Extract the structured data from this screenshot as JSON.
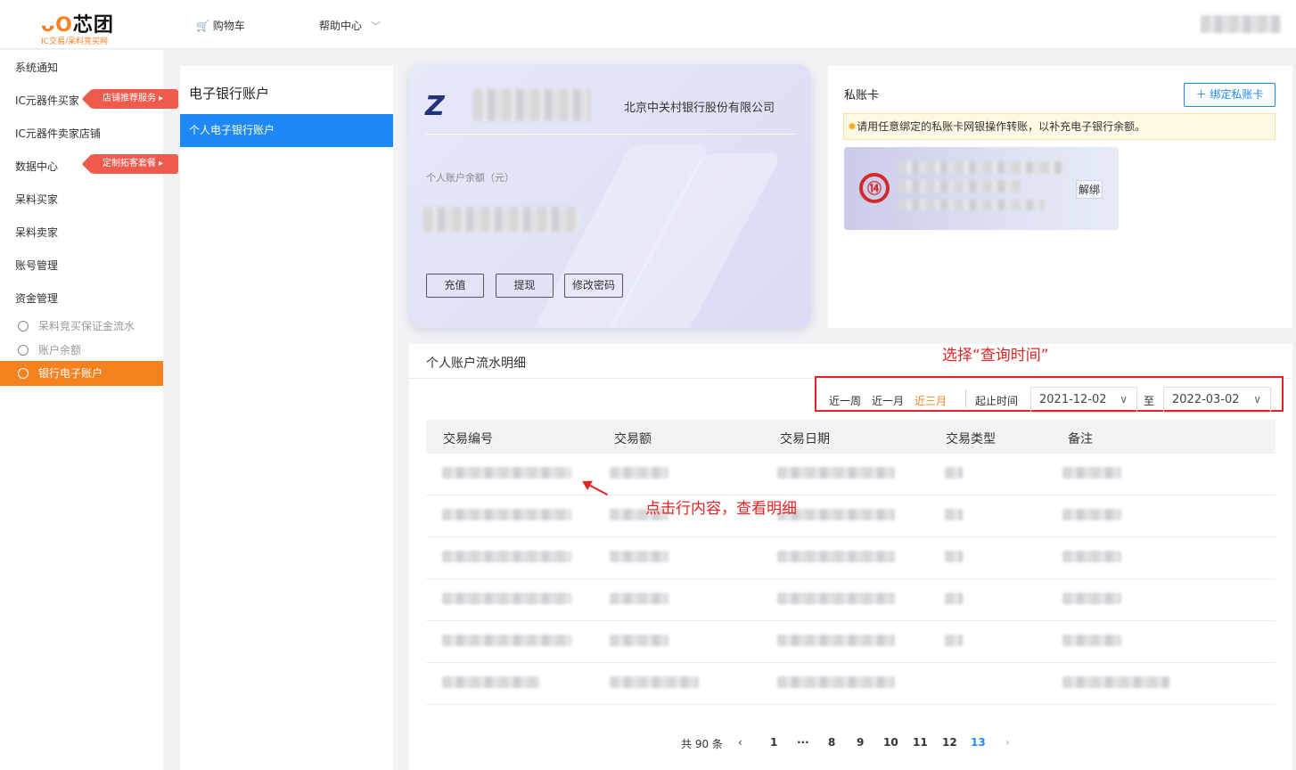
{
  "header": {
    "logo_main": "芯团",
    "logo_sub": "IC交易/呆料竞买网",
    "cart_label": "购物车",
    "help_label": "帮助中心"
  },
  "sidebar": {
    "items": [
      {
        "label": "系统通知"
      },
      {
        "label": "IC元器件买家",
        "tag": "店铺推荐服务"
      },
      {
        "label": "IC元器件卖家店铺"
      },
      {
        "label": "数据中心",
        "tag": "定制拓客套餐"
      },
      {
        "label": "呆料买家"
      },
      {
        "label": "呆料卖家"
      },
      {
        "label": "账号管理"
      },
      {
        "label": "资金管理"
      }
    ],
    "sub_items": [
      {
        "label": "呆料竞买保证金流水"
      },
      {
        "label": "账户余额"
      },
      {
        "label": "银行电子账户"
      }
    ]
  },
  "account_panel": {
    "title": "电子银行账户",
    "active_item": "个人电子银行账户"
  },
  "bank_card": {
    "bank_name": "北京中关村银行股份有限公司",
    "balance_label": "个人账户余额（元）",
    "buttons": {
      "recharge": "充值",
      "withdraw": "提现",
      "change_password": "修改密码"
    }
  },
  "private_card": {
    "title": "私账卡",
    "bind_button": "绑定私账卡",
    "notice": "请用任意绑定的私账卡网银操作转账，以补充电子银行余额。",
    "bank_badge": "⑭",
    "unbind_button": "解绑"
  },
  "detail": {
    "title": "个人账户流水明细",
    "quick_ranges": [
      "近一周",
      "近一月",
      "近三月"
    ],
    "selected_range": "近三月",
    "start_label": "起止时间",
    "start_date": "2021-12-02",
    "to_label": "至",
    "end_date": "2022-03-02",
    "columns": [
      "交易编号",
      "交易额",
      "交易日期",
      "交易类型",
      "备注"
    ],
    "row_count_visible": 6
  },
  "pagination": {
    "total": "共 90 条",
    "prev": "‹",
    "pages": [
      "1",
      "···",
      "8",
      "9",
      "10",
      "11",
      "12",
      "13"
    ],
    "current": "13",
    "next": "›"
  },
  "annotations": {
    "select_time": "选择“查询时间”",
    "click_row": "点击行内容，查看明细"
  },
  "colors": {
    "accent_orange": "#f5821f",
    "primary_blue": "#1e88f5",
    "tag_red": "#ee5b4d",
    "annotation_red": "#e32222"
  }
}
